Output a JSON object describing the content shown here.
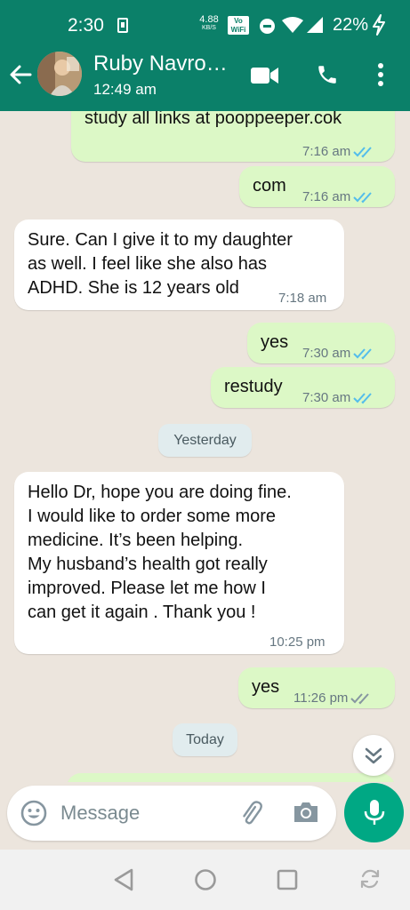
{
  "status_bar": {
    "time": "2:30",
    "net_speed_value": "4.88",
    "net_speed_unit": "KB/S",
    "vowifi_line1": "Vo",
    "vowifi_line2": "WiFi",
    "battery": "22%"
  },
  "header": {
    "contact_name": "Ruby Navro…",
    "subtitle": "12:49 am",
    "icons": [
      "back-arrow-icon",
      "video-call-icon",
      "phone-icon",
      "more-vert-icon"
    ]
  },
  "messages": [
    {
      "dir": "out",
      "text": "study all links at pooppeeper.cok",
      "time": "7:16 am",
      "status": "read"
    },
    {
      "dir": "out",
      "text": "com",
      "time": "7:16 am",
      "status": "read"
    },
    {
      "dir": "in",
      "lines": [
        "Sure. Can I give it to my daughter",
        "as well. I feel like she also has",
        "ADHD. She is 12 years old"
      ],
      "time": "7:18 am"
    },
    {
      "dir": "out",
      "text": "yes",
      "time": "7:30 am",
      "status": "read"
    },
    {
      "dir": "out",
      "text": "restudy",
      "time": "7:30 am",
      "status": "read"
    },
    {
      "dir": "in",
      "lines": [
        "Hello Dr, hope you are doing fine.",
        "I would like to order some more",
        "medicine. It’s been helping.",
        "My husband’s health got really",
        "improved. Please let me how I",
        "can get it again . Thank you !"
      ],
      "time": "10:25 pm"
    },
    {
      "dir": "out",
      "text": "yes",
      "time": "11:26 pm",
      "status": "delivered"
    }
  ],
  "date_separators": [
    "Yesterday",
    "Today"
  ],
  "colors": {
    "header": "#0b8069",
    "outgoing_bubble": "#dcf8c6",
    "incoming_bubble": "#ffffff",
    "read_ticks": "#53bdeb",
    "delivered_ticks": "#8696a0",
    "mic_button": "#00a884"
  },
  "composer": {
    "placeholder": "Message",
    "icons": [
      "emoji-icon",
      "attach-icon",
      "camera-icon",
      "mic-icon"
    ]
  }
}
